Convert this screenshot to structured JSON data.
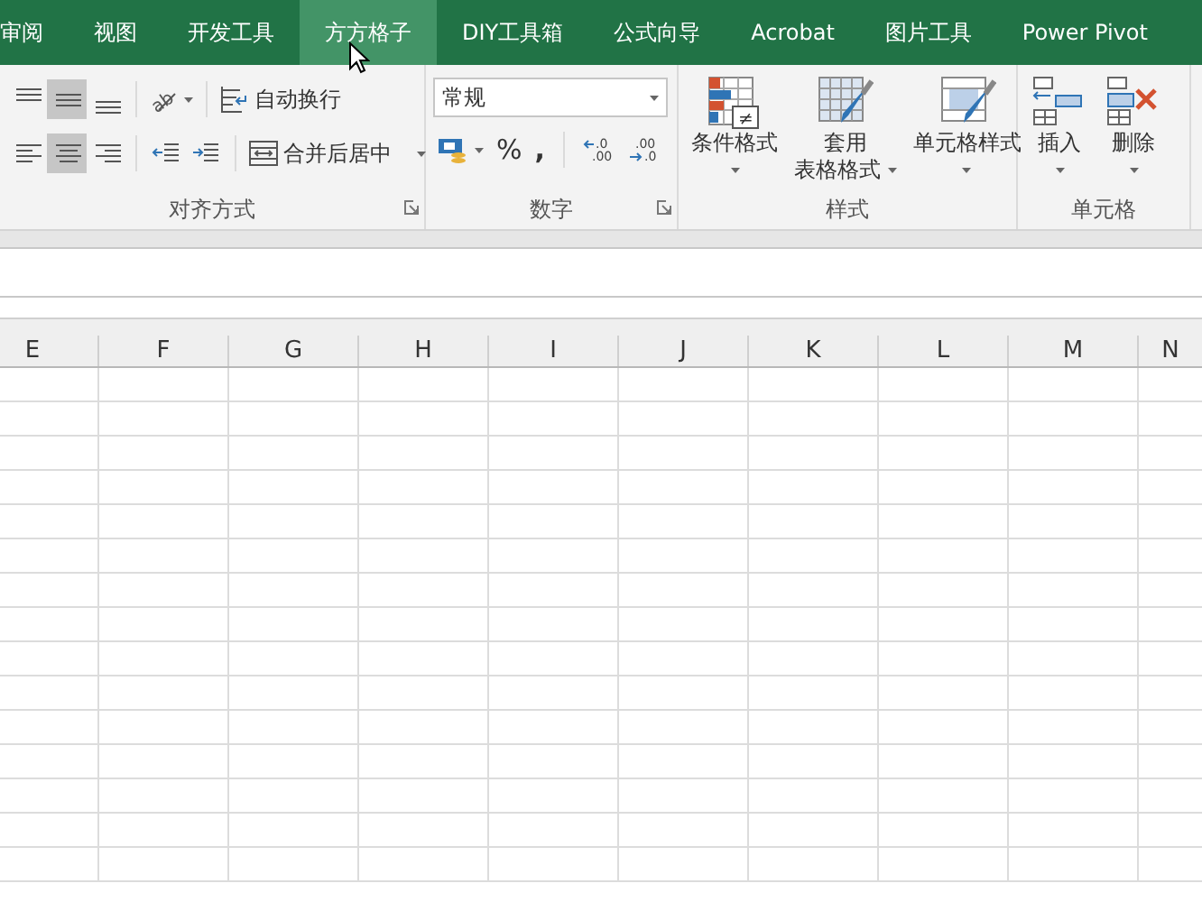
{
  "tabs": [
    {
      "label": "审阅",
      "selected": false
    },
    {
      "label": "视图",
      "selected": false
    },
    {
      "label": "开发工具",
      "selected": false
    },
    {
      "label": "方方格子",
      "selected": true
    },
    {
      "label": "DIY工具箱",
      "selected": false
    },
    {
      "label": "公式向导",
      "selected": false
    },
    {
      "label": "Acrobat",
      "selected": false
    },
    {
      "label": "图片工具",
      "selected": false
    },
    {
      "label": "Power Pivot",
      "selected": false
    }
  ],
  "alignment": {
    "label": "对齐方式",
    "vertical_buttons": [
      {
        "kind": "top",
        "selected": false
      },
      {
        "kind": "middle",
        "selected": true
      },
      {
        "kind": "bottom",
        "selected": false
      }
    ],
    "horizontal_buttons": [
      {
        "kind": "left",
        "selected": false
      },
      {
        "kind": "center",
        "selected": true
      },
      {
        "kind": "right",
        "selected": false
      }
    ],
    "orientation_glyph": "ab",
    "wrap_text": "自动换行",
    "merge_center": "合并后居中"
  },
  "number": {
    "label": "数字",
    "format": "常规",
    "percent": "%",
    "comma": ",",
    "increase_decimal": [
      ".0",
      ".00"
    ],
    "decrease_decimal": [
      ".00",
      ".0"
    ]
  },
  "styles": {
    "label": "样式",
    "buttons": [
      {
        "kind": "conditional",
        "glyph": "≠",
        "lines": [
          "条件格式"
        ]
      },
      {
        "kind": "table",
        "lines": [
          "套用",
          "表格格式"
        ]
      },
      {
        "kind": "cell",
        "lines": [
          "单元格样式"
        ]
      }
    ]
  },
  "cells": {
    "label": "单元格",
    "buttons": [
      {
        "kind": "insert",
        "lines": [
          "插入"
        ]
      },
      {
        "kind": "delete",
        "lines": [
          "删除"
        ]
      }
    ]
  },
  "grid": {
    "columns": [
      "E",
      "F",
      "G",
      "H",
      "I",
      "J",
      "K",
      "L",
      "M",
      "N"
    ]
  }
}
